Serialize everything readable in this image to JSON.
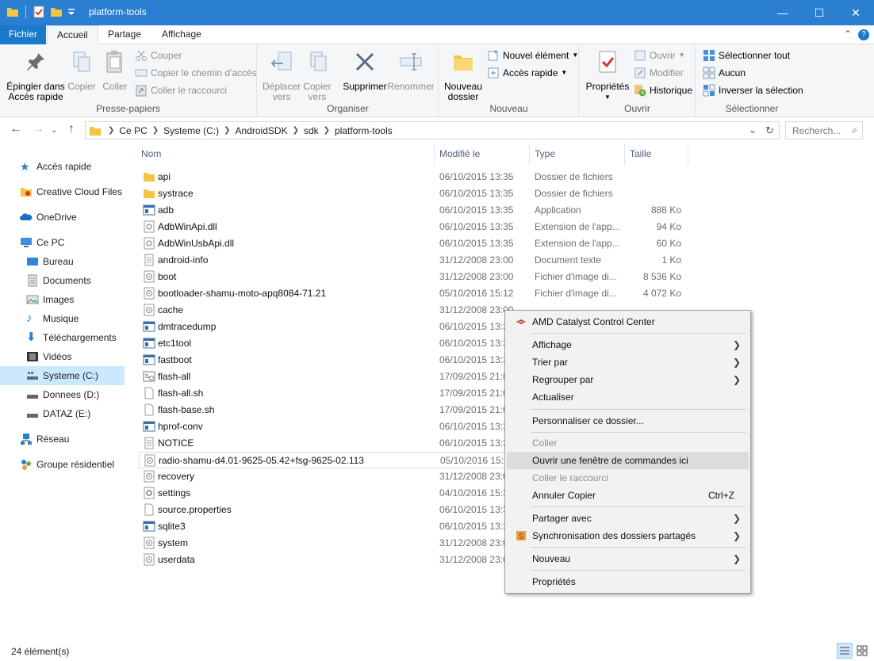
{
  "window": {
    "title": "platform-tools",
    "minimize_glyph": "—",
    "maximize_glyph": "☐",
    "close_glyph": "✕"
  },
  "tabs": {
    "file": "Fichier",
    "home": "Accueil",
    "share": "Partage",
    "view": "Affichage",
    "help": "?"
  },
  "ribbon": {
    "clipboard": {
      "label": "Presse-papiers",
      "pin_line1": "Épingler dans",
      "pin_line2": "Accès rapide",
      "copy": "Copier",
      "paste": "Coller",
      "cut": "Couper",
      "copy_path": "Copier le chemin d'accès",
      "paste_shortcut": "Coller le raccourci"
    },
    "organize": {
      "label": "Organiser",
      "move_line1": "Déplacer",
      "move_line2": "vers",
      "copy_line1": "Copier",
      "copy_line2": "vers",
      "delete": "Supprimer",
      "rename": "Renommer"
    },
    "new": {
      "label": "Nouveau",
      "folder_line1": "Nouveau",
      "folder_line2": "dossier",
      "new_item": "Nouvel élément",
      "easy_access": "Accès rapide"
    },
    "open": {
      "label": "Ouvrir",
      "properties": "Propriétés",
      "open": "Ouvrir",
      "edit": "Modifier",
      "history": "Historique"
    },
    "select": {
      "label": "Sélectionner",
      "select_all": "Sélectionner tout",
      "select_none": "Aucun",
      "invert": "Inverser la sélection"
    }
  },
  "address": {
    "crumbs": [
      "Ce PC",
      "Systeme (C:)",
      "AndroidSDK",
      "sdk",
      "platform-tools"
    ],
    "search_placeholder": "Recherch..."
  },
  "nav": {
    "quick_access": "Accès rapide",
    "creative_cloud": "Creative Cloud Files",
    "onedrive": "OneDrive",
    "this_pc": "Ce PC",
    "desktop": "Bureau",
    "documents": "Documents",
    "pictures": "Images",
    "music": "Musique",
    "downloads": "Téléchargements",
    "videos": "Vidéos",
    "drive_c": "Systeme (C:)",
    "drive_d": "Donnees (D:)",
    "drive_e": "DATAZ (E:)",
    "network": "Réseau",
    "homegroup": "Groupe résidentiel"
  },
  "columns": {
    "name": "Nom",
    "modified": "Modifié le",
    "type": "Type",
    "size": "Taille"
  },
  "files": [
    {
      "name": "api",
      "date": "06/10/2015 13:35",
      "type": "Dossier de fichiers",
      "size": "",
      "icon": "folder-icon"
    },
    {
      "name": "systrace",
      "date": "06/10/2015 13:35",
      "type": "Dossier de fichiers",
      "size": "",
      "icon": "folder-icon"
    },
    {
      "name": "adb",
      "date": "06/10/2015 13:35",
      "type": "Application",
      "size": "888 Ko",
      "icon": "app-icon"
    },
    {
      "name": "AdbWinApi.dll",
      "date": "06/10/2015 13:35",
      "type": "Extension de l'app...",
      "size": "94 Ko",
      "icon": "dll-icon"
    },
    {
      "name": "AdbWinUsbApi.dll",
      "date": "06/10/2015 13:35",
      "type": "Extension de l'app...",
      "size": "60 Ko",
      "icon": "dll-icon"
    },
    {
      "name": "android-info",
      "date": "31/12/2008 23:00",
      "type": "Document texte",
      "size": "1 Ko",
      "icon": "text-file-icon"
    },
    {
      "name": "boot",
      "date": "31/12/2008 23:00",
      "type": "Fichier d'image di...",
      "size": "8 536 Ko",
      "icon": "disk-image-icon"
    },
    {
      "name": "bootloader-shamu-moto-apq8084-71.21",
      "date": "05/10/2016 15:12",
      "type": "Fichier d'image di...",
      "size": "4 072 Ko",
      "icon": "disk-image-icon"
    },
    {
      "name": "cache",
      "date": "31/12/2008 23:00",
      "type": "",
      "size": "",
      "icon": "disk-image-icon"
    },
    {
      "name": "dmtracedump",
      "date": "06/10/2015 13:35",
      "type": "",
      "size": "",
      "icon": "app-icon"
    },
    {
      "name": "etc1tool",
      "date": "06/10/2015 13:35",
      "type": "",
      "size": "",
      "icon": "app-icon"
    },
    {
      "name": "fastboot",
      "date": "06/10/2015 13:35",
      "type": "",
      "size": "",
      "icon": "app-icon"
    },
    {
      "name": "flash-all",
      "date": "17/09/2015 21:01",
      "type": "",
      "size": "",
      "icon": "batch-icon"
    },
    {
      "name": "flash-all.sh",
      "date": "17/09/2015 21:01",
      "type": "",
      "size": "",
      "icon": "blank-file-icon"
    },
    {
      "name": "flash-base.sh",
      "date": "17/09/2015 21:01",
      "type": "",
      "size": "",
      "icon": "blank-file-icon"
    },
    {
      "name": "hprof-conv",
      "date": "06/10/2015 13:35",
      "type": "",
      "size": "",
      "icon": "app-icon"
    },
    {
      "name": "NOTICE",
      "date": "06/10/2015 13:35",
      "type": "",
      "size": "",
      "icon": "text-file-icon"
    },
    {
      "name": "radio-shamu-d4.01-9625-05.42+fsg-9625-02.113",
      "date": "05/10/2016 15:12",
      "type": "",
      "size": "",
      "icon": "disk-image-icon"
    },
    {
      "name": "recovery",
      "date": "31/12/2008 23:00",
      "type": "",
      "size": "",
      "icon": "disk-image-icon"
    },
    {
      "name": "settings",
      "date": "04/10/2016 15:35",
      "type": "",
      "size": "",
      "icon": "gear-file-icon"
    },
    {
      "name": "source.properties",
      "date": "06/10/2015 13:35",
      "type": "",
      "size": "",
      "icon": "blank-file-icon"
    },
    {
      "name": "sqlite3",
      "date": "06/10/2015 13:35",
      "type": "",
      "size": "",
      "icon": "app-icon"
    },
    {
      "name": "system",
      "date": "31/12/2008 23:00",
      "type": "",
      "size": "",
      "icon": "disk-image-icon"
    },
    {
      "name": "userdata",
      "date": "31/12/2008 23:00",
      "type": "",
      "size": "",
      "icon": "disk-image-icon"
    }
  ],
  "context_menu": {
    "amd": "AMD Catalyst Control Center",
    "view": "Affichage",
    "sort": "Trier par",
    "group": "Regrouper par",
    "refresh": "Actualiser",
    "customize": "Personnaliser ce dossier...",
    "paste": "Coller",
    "open_cmd": "Ouvrir une fenêtre de commandes ici",
    "paste_shortcut": "Coller le raccourci",
    "undo": "Annuler Copier",
    "undo_shortcut": "Ctrl+Z",
    "share": "Partager avec",
    "sync": "Synchronisation des dossiers partagés",
    "new": "Nouveau",
    "properties": "Propriétés"
  },
  "status": {
    "count": "24 élément(s)"
  },
  "colors": {
    "titlebar": "#2b7fd1",
    "file_tab": "#1979ca",
    "selection": "#cce8ff",
    "folder": "#f5c542"
  }
}
